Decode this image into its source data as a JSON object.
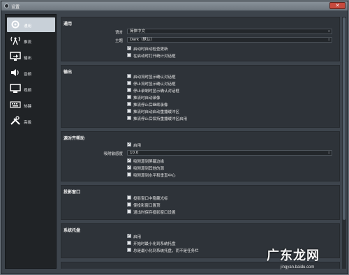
{
  "window": {
    "title": "设置",
    "close_glyph": "✕"
  },
  "sidebar": {
    "items": [
      {
        "label": "通用",
        "icon": "gear-icon",
        "active": true
      },
      {
        "label": "推流",
        "icon": "antenna-icon",
        "active": false
      },
      {
        "label": "输出",
        "icon": "monitor-output-icon",
        "active": false
      },
      {
        "label": "音频",
        "icon": "speaker-icon",
        "active": false
      },
      {
        "label": "视频",
        "icon": "display-icon",
        "active": false
      },
      {
        "label": "热键",
        "icon": "keyboard-icon",
        "active": false
      },
      {
        "label": "高级",
        "icon": "tools-icon",
        "active": false
      }
    ]
  },
  "general": {
    "title": "通用",
    "language_label": "语言",
    "language_value": "简体中文",
    "theme_label": "主题",
    "theme_value": "Dark（默认）",
    "check_updates": "启动时自动检查更新",
    "open_stats": "在启动时打开统计对话框"
  },
  "output": {
    "title": "输出",
    "items": [
      "启动流时显示确认对话框",
      "停止流时显示确认对话框",
      "停止录制时显示确认对话框",
      "推流时自动录像",
      "推流停止后继续录像",
      "推流时自动启动重播缓冲区",
      "推流停止后保持重播缓冲区启用"
    ]
  },
  "snap": {
    "title": "源对齐帮助",
    "enable": "启用",
    "sensitivity_label": "吸附敏感度",
    "sensitivity_value": "10.0",
    "items": [
      "吸附源到屏幕边缘",
      "吸附源到其他的源",
      "吸附源到水平和垂直中心"
    ]
  },
  "projector": {
    "title": "投影窗口",
    "items": [
      "投影窗口中隐藏光标",
      "使投影窗口置顶",
      "退出时保存投影窗口设置"
    ]
  },
  "tray": {
    "title": "系统托盘",
    "items": [
      "启用",
      "开始时最小化到系统托盘",
      "总是最小化到系统托盘，而不是任务栏"
    ]
  },
  "checks": {
    "general": [
      true,
      false
    ],
    "output": [
      false,
      false,
      false,
      false,
      false,
      false,
      false
    ],
    "snap_enable": true,
    "snap": [
      true,
      true,
      false
    ],
    "projector": [
      false,
      false,
      false
    ],
    "tray": [
      true,
      false,
      false
    ]
  },
  "watermark": {
    "text": "广东龙网",
    "url": "jingyan.baidu.com"
  },
  "colors": {
    "accent": "#c8d0d8",
    "panel": "#2e3339",
    "sidebar": "#202326"
  }
}
